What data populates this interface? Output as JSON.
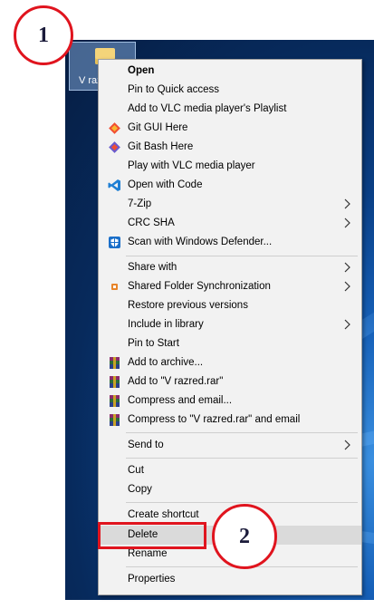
{
  "folder": {
    "name": "V razred"
  },
  "menu": {
    "items": [
      {
        "label": "Open",
        "bold": true
      },
      {
        "label": "Pin to Quick access"
      },
      {
        "label": "Add to VLC media player's Playlist"
      },
      {
        "label": "Git GUI Here",
        "icon": "git-gui-icon"
      },
      {
        "label": "Git Bash Here",
        "icon": "git-bash-icon"
      },
      {
        "label": "Play with VLC media player"
      },
      {
        "label": "Open with Code",
        "icon": "vscode-icon"
      },
      {
        "label": "7-Zip",
        "submenu": true
      },
      {
        "label": "CRC SHA",
        "submenu": true
      },
      {
        "label": "Scan with Windows Defender...",
        "icon": "windows-defender-icon"
      },
      {
        "label": "Share with",
        "submenu": true
      },
      {
        "label": "Shared Folder Synchronization",
        "icon": "sync-icon",
        "submenu": true
      },
      {
        "label": "Restore previous versions"
      },
      {
        "label": "Include in library",
        "submenu": true
      },
      {
        "label": "Pin to Start"
      },
      {
        "label": "Add to archive...",
        "icon": "winrar-icon"
      },
      {
        "label": "Add to \"V razred.rar\"",
        "icon": "winrar-icon"
      },
      {
        "label": "Compress and email...",
        "icon": "winrar-icon"
      },
      {
        "label": "Compress to \"V razred.rar\" and email",
        "icon": "winrar-icon"
      },
      {
        "label": "Send to",
        "submenu": true
      },
      {
        "label": "Cut"
      },
      {
        "label": "Copy"
      },
      {
        "label": "Create shortcut"
      },
      {
        "label": "Delete",
        "highlighted": true
      },
      {
        "label": "Rename"
      },
      {
        "label": "Properties"
      }
    ]
  },
  "annotations": {
    "step1": "1",
    "step2": "2"
  },
  "colors": {
    "annotation_red": "#e0141e",
    "menu_bg": "#f2f2f2",
    "highlight": "#dadada"
  }
}
